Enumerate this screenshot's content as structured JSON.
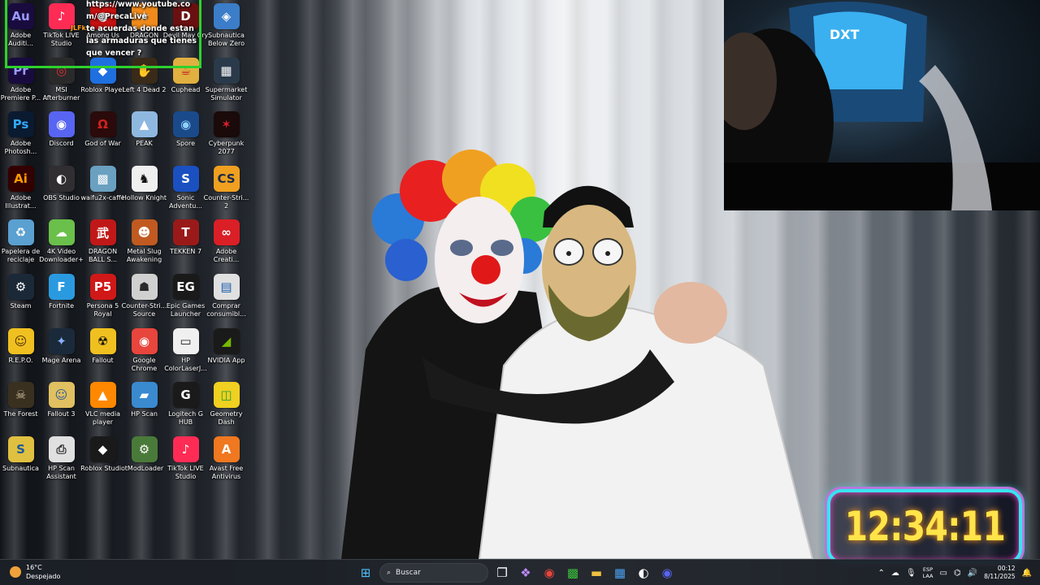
{
  "desktop": {
    "icons": [
      {
        "label": "Adobe Auditi...",
        "icon": "audition-icon",
        "color": "#1a0b3f",
        "fg": "#9a9aff",
        "glyph": "Au"
      },
      {
        "label": "TikTok LIVE Studio",
        "icon": "tiktok-icon",
        "color": "#fe2c55",
        "fg": "#ffffff",
        "glyph": "♪"
      },
      {
        "label": "Among Us",
        "icon": "among-us-icon",
        "color": "#c51111",
        "fg": "#ffffff",
        "glyph": "●"
      },
      {
        "label": "DRAGON",
        "icon": "dragon-ball-icon",
        "color": "#f08a1a",
        "fg": "#ffffff",
        "glyph": "★"
      },
      {
        "label": "Devil May Cry",
        "icon": "devil-may-cry-icon",
        "color": "#6a1010",
        "fg": "#ffffff",
        "glyph": "D"
      },
      {
        "label": "Subnautica Below Zero",
        "icon": "subnautica-bz-icon",
        "color": "#3b7dc8",
        "fg": "#ffffff",
        "glyph": "◈"
      },
      {
        "label": "Adobe Premiere P...",
        "icon": "premiere-icon",
        "color": "#1a0b3f",
        "fg": "#9a9aff",
        "glyph": "Pr"
      },
      {
        "label": "MSI Afterburner",
        "icon": "msi-afterburner-icon",
        "color": "#2a2a2a",
        "fg": "#e03030",
        "glyph": "◎"
      },
      {
        "label": "Roblox Player",
        "icon": "roblox-player-icon",
        "color": "#1e6fe0",
        "fg": "#ffffff",
        "glyph": "◆"
      },
      {
        "label": "Left 4 Dead 2",
        "icon": "left4dead-icon",
        "color": "#3a2a18",
        "fg": "#ffffff",
        "glyph": "✋"
      },
      {
        "label": "Cuphead",
        "icon": "cuphead-icon",
        "color": "#e0b040",
        "fg": "#c02020",
        "glyph": "☕"
      },
      {
        "label": "Supermarket Simulator",
        "icon": "supermarket-icon",
        "color": "#2a3a4a",
        "fg": "#ffffff",
        "glyph": "▦"
      },
      {
        "label": "Adobe Photosh...",
        "icon": "photoshop-icon",
        "color": "#0a1a30",
        "fg": "#31a8ff",
        "glyph": "Ps"
      },
      {
        "label": "Discord",
        "icon": "discord-icon",
        "color": "#5865f2",
        "fg": "#ffffff",
        "glyph": "◉"
      },
      {
        "label": "God of War",
        "icon": "god-of-war-icon",
        "color": "#2a0a0a",
        "fg": "#d02020",
        "glyph": "Ω"
      },
      {
        "label": "PEAK",
        "icon": "peak-icon",
        "color": "#8fb8e0",
        "fg": "#ffffff",
        "glyph": "▲"
      },
      {
        "label": "Spore",
        "icon": "spore-icon",
        "color": "#1a4a8a",
        "fg": "#8fd0ff",
        "glyph": "◉"
      },
      {
        "label": "Cyberpunk 2077",
        "icon": "cyberpunk-icon",
        "color": "#1a0a0a",
        "fg": "#e02030",
        "glyph": "✶"
      },
      {
        "label": "Adobe Illustrat...",
        "icon": "illustrator-icon",
        "color": "#330000",
        "fg": "#ff9a00",
        "glyph": "Ai"
      },
      {
        "label": "OBS Studio",
        "icon": "obs-icon",
        "color": "#302e31",
        "fg": "#ffffff",
        "glyph": "◐"
      },
      {
        "label": "waifu2x-caffe",
        "icon": "waifu2x-icon",
        "color": "#6aa0c0",
        "fg": "#ffffff",
        "glyph": "▩"
      },
      {
        "label": "Hollow Knight",
        "icon": "hollow-knight-icon",
        "color": "#f0f0f0",
        "fg": "#111111",
        "glyph": "♞"
      },
      {
        "label": "Sonic Adventu...",
        "icon": "sonic-icon",
        "color": "#1a50c0",
        "fg": "#ffffff",
        "glyph": "S"
      },
      {
        "label": "Counter-Stri... 2",
        "icon": "cs2-icon",
        "color": "#f0a020",
        "fg": "#1a2a4a",
        "glyph": "CS"
      },
      {
        "label": "Papelera de reciclaje",
        "icon": "recycle-bin-icon",
        "color": "#5aa0d0",
        "fg": "#ffffff",
        "glyph": "♻"
      },
      {
        "label": "4K Video Downloader+",
        "icon": "4k-downloader-icon",
        "color": "#6ac04a",
        "fg": "#ffffff",
        "glyph": "☁"
      },
      {
        "label": "DRAGON BALL S...",
        "icon": "dragon-ball-s-icon",
        "color": "#c01818",
        "fg": "#ffffff",
        "glyph": "武"
      },
      {
        "label": "Metal Slug Awakening",
        "icon": "metal-slug-icon",
        "color": "#c05a20",
        "fg": "#ffffff",
        "glyph": "☻"
      },
      {
        "label": "TEKKEN 7",
        "icon": "tekken-icon",
        "color": "#9a1a1a",
        "fg": "#ffffff",
        "glyph": "T"
      },
      {
        "label": "Adobe Creati...",
        "icon": "creative-cloud-icon",
        "color": "#da1f26",
        "fg": "#ffffff",
        "glyph": "∞"
      },
      {
        "label": "Steam",
        "icon": "steam-icon",
        "color": "#1b2838",
        "fg": "#ffffff",
        "glyph": "⚙"
      },
      {
        "label": "Fortnite",
        "icon": "fortnite-icon",
        "color": "#2a9ae0",
        "fg": "#ffffff",
        "glyph": "F"
      },
      {
        "label": "Persona 5 Royal",
        "icon": "persona5-icon",
        "color": "#d01818",
        "fg": "#ffffff",
        "glyph": "P5"
      },
      {
        "label": "Counter-Stri... Source",
        "icon": "css-icon",
        "color": "#d0d0d0",
        "fg": "#2a2a2a",
        "glyph": "☗"
      },
      {
        "label": "Epic Games Launcher",
        "icon": "epic-games-icon",
        "color": "#1a1a1a",
        "fg": "#ffffff",
        "glyph": "EG"
      },
      {
        "label": "Comprar consumibl...",
        "icon": "hp-supplies-icon",
        "color": "#e0e0e0",
        "fg": "#1a5ab0",
        "glyph": "▤"
      },
      {
        "label": "R.E.P.O.",
        "icon": "repo-icon",
        "color": "#f0c020",
        "fg": "#4a2a00",
        "glyph": "☺"
      },
      {
        "label": "Mage Arena",
        "icon": "mage-arena-icon",
        "color": "#1a2a3a",
        "fg": "#8ab0ff",
        "glyph": "✦"
      },
      {
        "label": "Fallout",
        "icon": "fallout-icon",
        "color": "#f0c020",
        "fg": "#111111",
        "glyph": "☢"
      },
      {
        "label": "Google Chrome",
        "icon": "chrome-icon",
        "color": "#e8453c",
        "fg": "#ffffff",
        "glyph": "◉"
      },
      {
        "label": "HP ColorLaserJ...",
        "icon": "hp-printer-icon",
        "color": "#f0f0f0",
        "fg": "#1a1a1a",
        "glyph": "▭"
      },
      {
        "label": "NVIDIA App",
        "icon": "nvidia-icon",
        "color": "#1a1a1a",
        "fg": "#76b900",
        "glyph": "◢"
      },
      {
        "label": "The Forest",
        "icon": "the-forest-icon",
        "color": "#3a3020",
        "fg": "#d0c0a0",
        "glyph": "☠"
      },
      {
        "label": "Fallout 3",
        "icon": "fallout3-icon",
        "color": "#e0c060",
        "fg": "#2a5a9a",
        "glyph": "☺"
      },
      {
        "label": "VLC media player",
        "icon": "vlc-icon",
        "color": "#ff8800",
        "fg": "#ffffff",
        "glyph": "▲"
      },
      {
        "label": "HP Scan",
        "icon": "hp-scan-icon",
        "color": "#3a8ad0",
        "fg": "#ffffff",
        "glyph": "▰"
      },
      {
        "label": "Logitech G HUB",
        "icon": "logitech-icon",
        "color": "#1a1a1a",
        "fg": "#ffffff",
        "glyph": "G"
      },
      {
        "label": "Geometry Dash",
        "icon": "geometry-dash-icon",
        "color": "#f0d020",
        "fg": "#20a040",
        "glyph": "◫"
      },
      {
        "label": "Subnautica",
        "icon": "subnautica-icon",
        "color": "#e0c040",
        "fg": "#1a5a9a",
        "glyph": "S"
      },
      {
        "label": "HP Scan Assistant",
        "icon": "hp-scan-assistant-icon",
        "color": "#e0e0e0",
        "fg": "#2a2a2a",
        "glyph": "⎙"
      },
      {
        "label": "Roblox Studio",
        "icon": "roblox-studio-icon",
        "color": "#1a1a1a",
        "fg": "#ffffff",
        "glyph": "◆"
      },
      {
        "label": "tModLoader",
        "icon": "tmodloader-icon",
        "color": "#4a7a3a",
        "fg": "#ffffff",
        "glyph": "⚙"
      },
      {
        "label": "TikTok LIVE Studio",
        "icon": "tiktok-live-icon",
        "color": "#fe2c55",
        "fg": "#ffffff",
        "glyph": "♪"
      },
      {
        "label": "Avast Free Antivirus",
        "icon": "avast-icon",
        "color": "#f07820",
        "fg": "#ffffff",
        "glyph": "A"
      }
    ]
  },
  "chat": {
    "user": "JLFkr",
    "lines": [
      "https://www.youtube.co",
      "m/@PrecaLive",
      "te acuerdas donde estan",
      "las armaduras que tienes",
      "que vencer ?"
    ]
  },
  "clock": {
    "time": "12:34:11"
  },
  "taskbar": {
    "weather": {
      "temp": "16°C",
      "condition": "Despejado"
    },
    "search_placeholder": "Buscar",
    "apps": [
      {
        "icon": "start-windows-icon",
        "glyph": "⊞",
        "color": "#4cc2ff"
      },
      {
        "icon": "search-icon",
        "glyph": "⌕",
        "color": "#ffffff"
      },
      {
        "icon": "task-view-icon",
        "glyph": "❐",
        "color": "#ffffff"
      },
      {
        "icon": "copilot-icon",
        "glyph": "❖",
        "color": "#c08aff"
      },
      {
        "icon": "chrome-taskbar-icon",
        "glyph": "◉",
        "color": "#e8453c"
      },
      {
        "icon": "minecraft-icon",
        "glyph": "▩",
        "color": "#3ac03a"
      },
      {
        "icon": "file-explorer-icon",
        "glyph": "▬",
        "color": "#f0c040"
      },
      {
        "icon": "store-icon",
        "glyph": "▦",
        "color": "#4aa0f0"
      },
      {
        "icon": "obs-taskbar-icon",
        "glyph": "◐",
        "color": "#ffffff"
      },
      {
        "icon": "discord-taskbar-icon",
        "glyph": "◉",
        "color": "#5865f2"
      }
    ],
    "tray": {
      "language_top": "ESP",
      "language_bottom": "LAA",
      "time": "00:12",
      "date": "8/11/2025",
      "icons": [
        {
          "icon": "chevron-up-icon",
          "glyph": "⌃"
        },
        {
          "icon": "onedrive-icon",
          "glyph": "☁"
        },
        {
          "icon": "microphone-icon",
          "glyph": "🎙"
        },
        {
          "icon": "monitor-icon",
          "glyph": "▭"
        },
        {
          "icon": "network-icon",
          "glyph": "⌬"
        },
        {
          "icon": "volume-icon",
          "glyph": "🔊"
        },
        {
          "icon": "notification-icon",
          "glyph": "🔔"
        }
      ]
    }
  }
}
